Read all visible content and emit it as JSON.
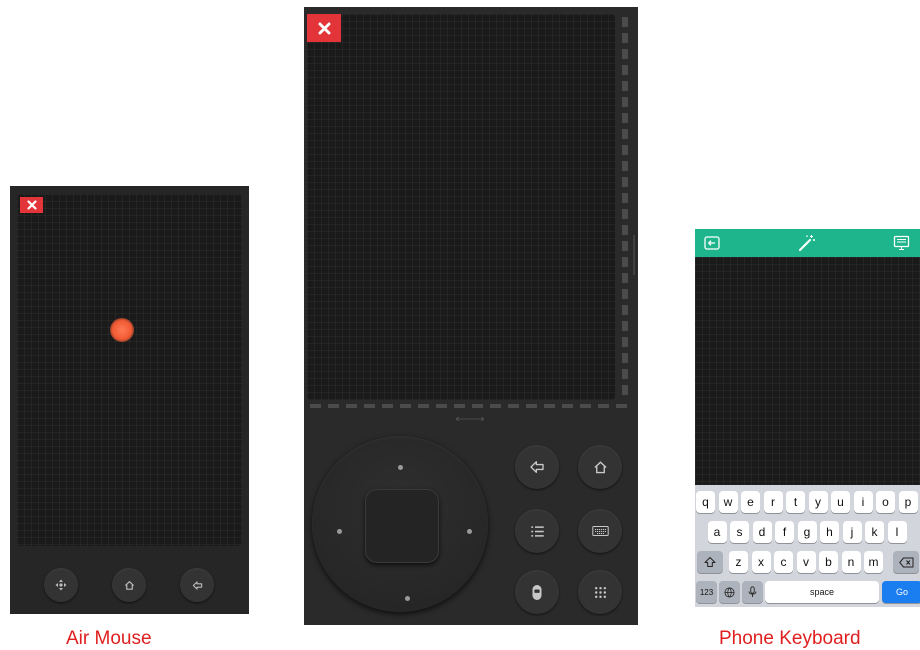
{
  "colors": {
    "close_red": "#e3343a",
    "caption_red": "#e02020",
    "keyboard_green": "#1fb58c",
    "go_blue": "#1a7df0",
    "cursor_orange": "#f15a33"
  },
  "air_mouse": {
    "caption": "Air Mouse",
    "close_icon": "close-icon",
    "buttons": [
      {
        "name": "move-cross-icon"
      },
      {
        "name": "home-icon"
      },
      {
        "name": "back-arrow-icon"
      }
    ]
  },
  "touchpad_remote": {
    "close_icon": "close-icon",
    "dpad": [
      "up",
      "left",
      "right",
      "down",
      "ok"
    ],
    "buttons": [
      {
        "name": "back-arrow-icon"
      },
      {
        "name": "home-icon"
      },
      {
        "name": "menu-list-icon"
      },
      {
        "name": "keyboard-icon"
      },
      {
        "name": "mouse-icon"
      },
      {
        "name": "grid-icon"
      }
    ]
  },
  "phone_keyboard": {
    "caption": "Phone Keyboard",
    "top_bar_icons": [
      "input-icon",
      "magic-wand-icon",
      "screen-icon"
    ],
    "rows": [
      [
        "q",
        "w",
        "e",
        "r",
        "t",
        "y",
        "u",
        "i",
        "o",
        "p"
      ],
      [
        "a",
        "s",
        "d",
        "f",
        "g",
        "h",
        "j",
        "k",
        "l"
      ],
      [
        "z",
        "x",
        "c",
        "v",
        "b",
        "n",
        "m"
      ]
    ],
    "numbers_key": "123",
    "space_key": "space",
    "go_key": "Go"
  }
}
